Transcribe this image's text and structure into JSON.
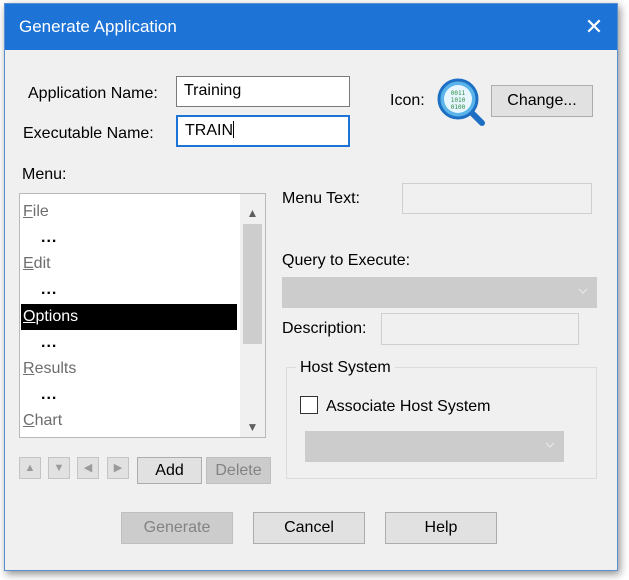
{
  "window": {
    "title": "Generate Application",
    "close_glyph": "✕"
  },
  "app_name": {
    "label": "Application Name:",
    "value": "Training"
  },
  "exe_name": {
    "label": "Executable Name:",
    "value": "TRAIN"
  },
  "icon": {
    "label": "Icon:",
    "change_label": "Change...",
    "icon_name": "data-search-icon"
  },
  "menu": {
    "label": "Menu:",
    "items": [
      {
        "text": "File",
        "accel": "F",
        "rest": "ile"
      },
      {
        "text": "..."
      },
      {
        "text": "Edit",
        "accel": "E",
        "rest": "dit"
      },
      {
        "text": "..."
      },
      {
        "text": "Options",
        "accel": "O",
        "rest": "ptions",
        "selected": true
      },
      {
        "text": "..."
      },
      {
        "text": "Results",
        "accel": "R",
        "rest": "esults"
      },
      {
        "text": "..."
      },
      {
        "text": "Chart",
        "accel": "C",
        "rest": "hart"
      }
    ],
    "add_label": "Add",
    "delete_label": "Delete"
  },
  "menu_text": {
    "label": "Menu Text:",
    "value": ""
  },
  "query": {
    "label": "Query to Execute:",
    "value": ""
  },
  "description": {
    "label": "Description:",
    "value": ""
  },
  "host": {
    "group_label": "Host System",
    "checkbox_label": "Associate Host System",
    "checked": false,
    "value": ""
  },
  "buttons": {
    "generate": "Generate",
    "cancel": "Cancel",
    "help": "Help"
  }
}
